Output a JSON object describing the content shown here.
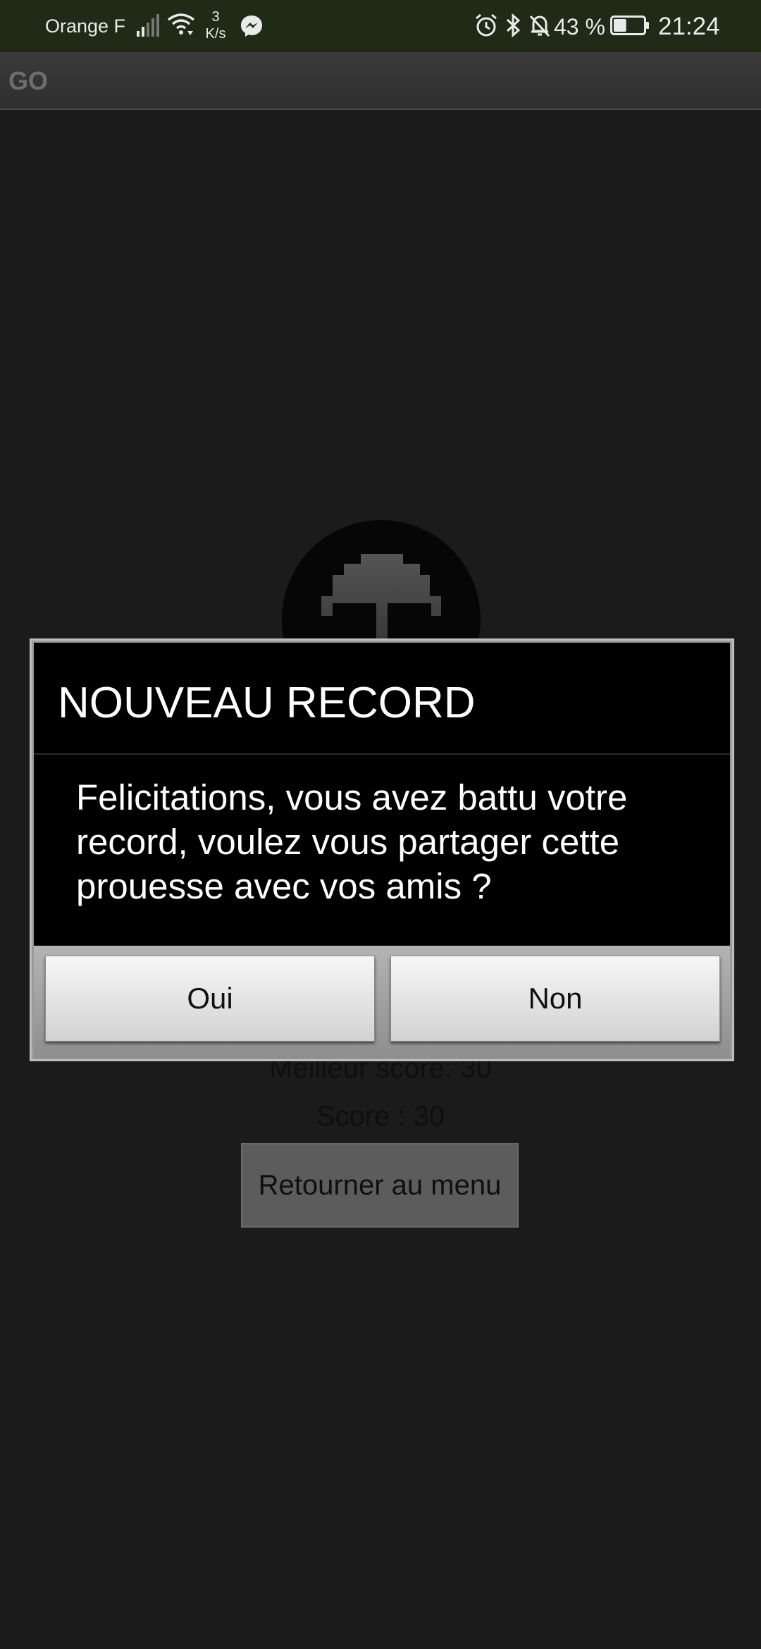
{
  "status_bar": {
    "carrier": "Orange F",
    "network_speed_value": "3",
    "network_speed_unit": "K/s",
    "battery_percent": "43 %",
    "battery_level": 0.43,
    "time": "21:24",
    "icons": [
      "signal-icon",
      "wifi-icon",
      "messenger-icon",
      "alarm-icon",
      "bluetooth-icon",
      "notifications-off-icon",
      "battery-icon"
    ]
  },
  "app_bar": {
    "title": "GO"
  },
  "game_over": {
    "best_score_label": "Meilleur score: 30",
    "score_label": "Score : 30",
    "menu_button": "Retourner au menu"
  },
  "dialog": {
    "title": "NOUVEAU RECORD",
    "message": "Felicitations, vous avez battu votre record, voulez vous partager cette prouesse avec vos amis ?",
    "yes_button": "Oui",
    "no_button": "Non"
  },
  "colors": {
    "status_bar_bg": "#1f2a17",
    "background": "#1b1b1b",
    "dialog_bg": "#000000",
    "dialog_button_bg": "#e6e6e6"
  }
}
